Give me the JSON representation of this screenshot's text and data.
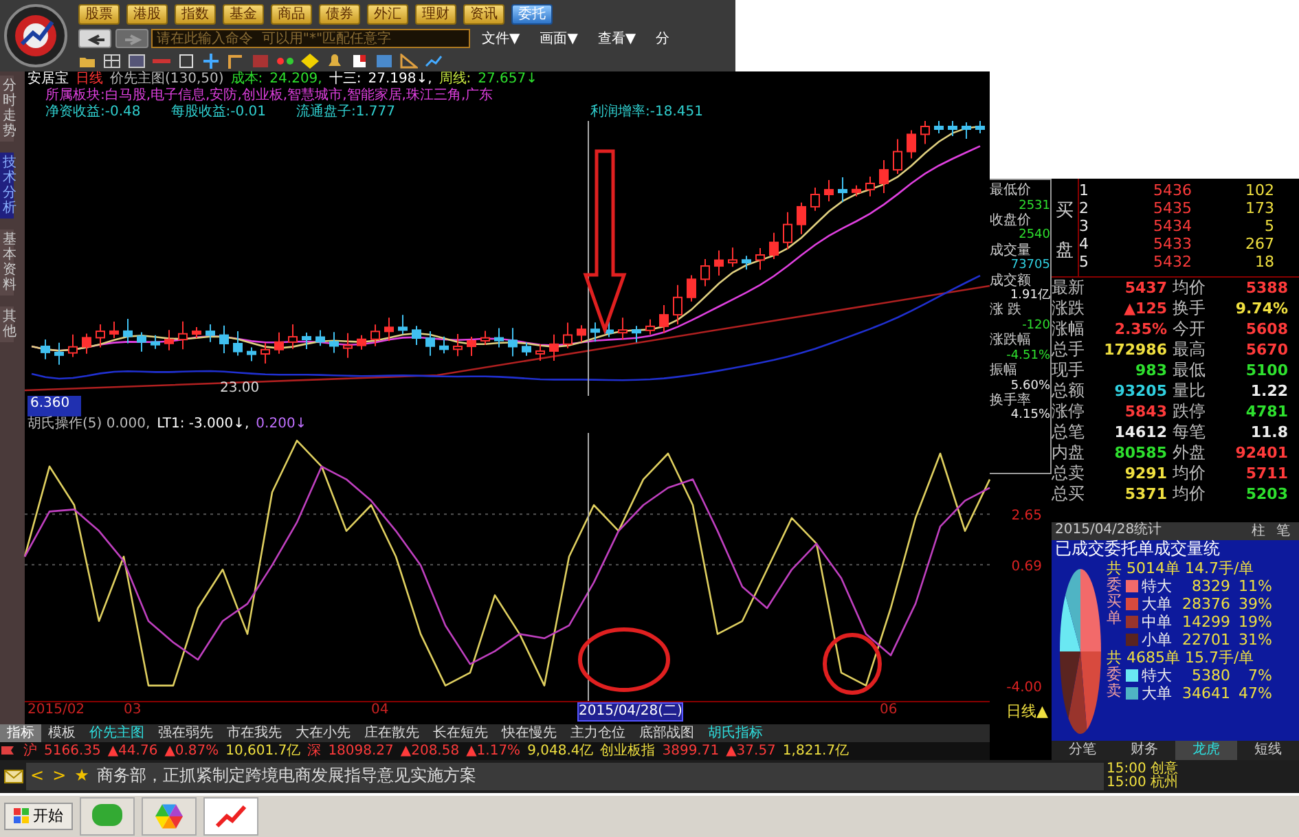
{
  "market_tabs": [
    {
      "label": "股票",
      "selected": false
    },
    {
      "label": "港股",
      "selected": false
    },
    {
      "label": "指数",
      "selected": false
    },
    {
      "label": "基金",
      "selected": false
    },
    {
      "label": "商品",
      "selected": false
    },
    {
      "label": "债券",
      "selected": false
    },
    {
      "label": "外汇",
      "selected": false
    },
    {
      "label": "理财",
      "selected": false
    },
    {
      "label": "资讯",
      "selected": false
    },
    {
      "label": "委托",
      "selected": true
    }
  ],
  "history": {
    "back_enabled": true,
    "forward_enabled": false
  },
  "command": {
    "placeholder": "请在此输入命令  可以用\"*\"匹配任意字"
  },
  "menus": [
    "文件▼",
    "画面▼",
    "查看▼",
    "分"
  ],
  "side_tabs": [
    {
      "label": "分时走势",
      "selected": false
    },
    {
      "label": "技术分析",
      "selected": true
    },
    {
      "label": "基本资料",
      "selected": false
    },
    {
      "label": "其他",
      "selected": false
    }
  ],
  "chart": {
    "info_line": [
      {
        "text": "安居宝",
        "kind": "stock"
      },
      {
        "text": "日线",
        "kind": "period"
      },
      {
        "text": "价先主图(130,50)",
        "kind": "plain"
      },
      {
        "text": "成本:",
        "kind": "key"
      },
      {
        "text": "24.209,",
        "kind": "key"
      },
      {
        "text": "十三:",
        "kind": "white"
      },
      {
        "text": "27.198↓,",
        "kind": "white"
      },
      {
        "text": "周线:",
        "kind": "lime"
      },
      {
        "text": "27.657↓",
        "kind": "key"
      }
    ],
    "sectors": "所属板块:白马股,电子信息,安防,创业板,智慧城市,智能家居,珠江三角,广东",
    "fundamentals": [
      "净资收益:-0.48",
      "每股收益:-0.01",
      "流通盘子:1.777",
      "利润增率:-18.451"
    ],
    "low_label": "23.00",
    "price_tag": "6.360",
    "indicator_line": [
      {
        "text": "胡氏操作(5) 0.000,",
        "kind": "plain"
      },
      {
        "text": "LT1: -3.000↓,",
        "kind": "white"
      },
      {
        "text": "0.200↓",
        "kind": "purple"
      }
    ],
    "indicator_chart": {
      "chart_data": {
        "type": "line",
        "ylim": [
          -4.6,
          5.8
        ],
        "yticks": [
          {
            "value": 2.65,
            "label": "2.65"
          },
          {
            "value": 0.69,
            "label": "0.69"
          },
          {
            "value": -4,
            "label": "-4.00"
          }
        ],
        "series": [
          {
            "color": "#e0d060",
            "values": [
              1.0,
              4.5,
              3.0,
              -1.5,
              1.0,
              -4.0,
              -4.0,
              -1.0,
              0.5,
              -2.0,
              3.5,
              5.5,
              4.5,
              2.0,
              3.0,
              1.0,
              -2.0,
              -4.0,
              -3.5,
              -0.5,
              -2.0,
              -4.0,
              1.0,
              3.0,
              2.0,
              4.0,
              5.0,
              3.0,
              -2.0,
              -1.5,
              0.5,
              2.5,
              1.5,
              -3.5,
              -4.0,
              -1.0,
              2.5,
              5.0,
              2.0,
              4.0
            ]
          },
          {
            "color": "#c040c0",
            "values": [
              1.0,
              2.75,
              2.83,
              2.0,
              0.83,
              -1.5,
              -2.33,
              -3.0,
              -1.5,
              -0.83,
              0.67,
              2.33,
              4.5,
              4.0,
              3.17,
              2.0,
              0.67,
              -1.67,
              -3.17,
              -2.67,
              -2.0,
              -2.17,
              -1.67,
              0.0,
              2.0,
              3.0,
              3.67,
              4.0,
              2.0,
              -0.17,
              -1.0,
              0.5,
              1.5,
              0.17,
              -2.0,
              -2.83,
              -0.83,
              2.17,
              3.17,
              3.67
            ]
          }
        ]
      }
    },
    "dates": [
      {
        "text": "2015/02",
        "selected": false
      },
      {
        "text": "03",
        "selected": false
      },
      {
        "text": "04",
        "selected": false
      },
      {
        "text": "2015/04/28(二)",
        "selected": true
      },
      {
        "text": "06",
        "selected": false
      }
    ],
    "period_switch": "日线▲"
  },
  "formula_tabs": [
    {
      "label": "指标",
      "selected": true,
      "active": false
    },
    {
      "label": "模板",
      "selected": false,
      "active": false
    },
    {
      "label": "价先主图",
      "selected": false,
      "active": true
    },
    {
      "label": "强在弱先",
      "selected": false,
      "active": false
    },
    {
      "label": "市在我先",
      "selected": false,
      "active": false
    },
    {
      "label": "大在小先",
      "selected": false,
      "active": false
    },
    {
      "label": "庄在散先",
      "selected": false,
      "active": false
    },
    {
      "label": "长在短先",
      "selected": false,
      "active": false
    },
    {
      "label": "快在慢先",
      "selected": false,
      "active": false
    },
    {
      "label": "主力仓位",
      "selected": false,
      "active": false
    },
    {
      "label": "底部战图",
      "selected": false,
      "active": false
    },
    {
      "label": "胡氏指标",
      "selected": false,
      "active": true
    }
  ],
  "indices": [
    {
      "name": "沪",
      "value": "5166.35",
      "change": "▲44.76",
      "pct": "▲0.87%",
      "amount": "10,601.7亿"
    },
    {
      "name": "深",
      "value": "18098.27",
      "change": "▲208.58",
      "pct": "▲1.17%",
      "amount": "9,048.4亿"
    },
    {
      "name": "创业板指",
      "value": "3899.71",
      "change": "▲37.57",
      "amount": "1,821.7亿"
    }
  ],
  "quote": {
    "summary": [
      {
        "label": "最低价",
        "value": "2531",
        "kind": "down"
      },
      {
        "label": "收盘价",
        "value": "2540",
        "kind": "down"
      },
      {
        "label": "成交量",
        "value": "73705",
        "kind": "amt"
      },
      {
        "label": "成交额",
        "value": "1.91亿",
        "kind": "plain"
      },
      {
        "label": "涨 跌",
        "value": "-120",
        "kind": "down"
      },
      {
        "label": "涨跌幅",
        "value": "-4.51%",
        "kind": "down"
      },
      {
        "label": "振幅",
        "value": "5.60%",
        "kind": "plain"
      },
      {
        "label": "换手率",
        "value": "4.15%",
        "kind": "plain"
      }
    ],
    "bid_label": "买盘",
    "bids": [
      {
        "level": "1",
        "price": "5436",
        "volume": "102"
      },
      {
        "level": "2",
        "price": "5435",
        "volume": "173"
      },
      {
        "level": "3",
        "price": "5434",
        "volume": "5"
      },
      {
        "level": "4",
        "price": "5433",
        "volume": "267"
      },
      {
        "level": "5",
        "price": "5432",
        "volume": "18"
      }
    ],
    "fields": [
      [
        {
          "label": "最新",
          "value": "5437",
          "kind": "up"
        },
        {
          "label": "均价",
          "value": "5388",
          "kind": "up"
        }
      ],
      [
        {
          "label": "涨跌",
          "value": "▲125",
          "kind": "up"
        },
        {
          "label": "换手",
          "value": "9.74%",
          "kind": "vol"
        }
      ],
      [
        {
          "label": "涨幅",
          "value": "2.35%",
          "kind": "up"
        },
        {
          "label": "今开",
          "value": "5608",
          "kind": "up"
        }
      ],
      [
        {
          "label": "总手",
          "value": "172986",
          "kind": "vol"
        },
        {
          "label": "最高",
          "value": "5670",
          "kind": "up"
        }
      ],
      [
        {
          "label": "现手",
          "value": "983",
          "kind": "down"
        },
        {
          "label": "最低",
          "value": "5100",
          "kind": "down"
        }
      ],
      [
        {
          "label": "总额",
          "value": "93205",
          "kind": "amt"
        },
        {
          "label": "量比",
          "value": "1.22",
          "kind": "plain"
        }
      ],
      [
        {
          "label": "涨停",
          "value": "5843",
          "kind": "up"
        },
        {
          "label": "跌停",
          "value": "4781",
          "kind": "down"
        }
      ],
      [
        {
          "label": "总笔",
          "value": "14612",
          "kind": "plain"
        },
        {
          "label": "每笔",
          "value": "11.8",
          "kind": "plain"
        }
      ],
      [
        {
          "label": "内盘",
          "value": "80585",
          "kind": "down"
        },
        {
          "label": "外盘",
          "value": "92401",
          "kind": "up"
        }
      ],
      [
        {
          "label": "总卖",
          "value": "9291",
          "kind": "vol"
        },
        {
          "label": "均价",
          "value": "5711",
          "kind": "up"
        }
      ],
      [
        {
          "label": "总买",
          "value": "5371",
          "kind": "vol"
        },
        {
          "label": "均价",
          "value": "5203",
          "kind": "down"
        }
      ]
    ]
  },
  "stats": {
    "date": "2015/04/28统计",
    "modes": [
      {
        "label": "柱",
        "selected": false
      },
      {
        "label": "笔",
        "selected": false
      }
    ],
    "title": "已成交委托单成交量统",
    "groups": [
      {
        "label": "委买单",
        "summary": "共 5014单 14.7手/单",
        "rows": [
          {
            "name": "特大",
            "volume": "8329",
            "pct": "11%",
            "color": "#f26a6a"
          },
          {
            "name": "大单",
            "volume": "28376",
            "pct": "39%",
            "color": "#d84a3e"
          },
          {
            "name": "中单",
            "volume": "14299",
            "pct": "19%",
            "color": "#99342c"
          },
          {
            "name": "小单",
            "volume": "22701",
            "pct": "31%",
            "color": "#5a2420"
          }
        ]
      },
      {
        "label": "委卖",
        "summary": "共 4685单 15.7手/单",
        "rows": [
          {
            "name": "特大",
            "volume": "5380",
            "pct": "7%",
            "color": "#6ae8f2"
          },
          {
            "name": "大单",
            "volume": "34641",
            "pct": "47%",
            "color": "#4fb4c4"
          }
        ]
      }
    ],
    "tabs": [
      {
        "label": "分笔",
        "selected": false
      },
      {
        "label": "财务",
        "selected": false
      },
      {
        "label": "龙虎",
        "selected": true
      },
      {
        "label": "短线",
        "selected": false
      }
    ]
  },
  "news": {
    "prev": "<",
    "next": ">",
    "star": "★",
    "headline": "商务部，正抓紧制定跨境电商发展指导意见实施方案",
    "flashes": [
      "15:00 创意",
      "15:00 杭州"
    ]
  },
  "taskbar": {
    "start": "开始"
  }
}
